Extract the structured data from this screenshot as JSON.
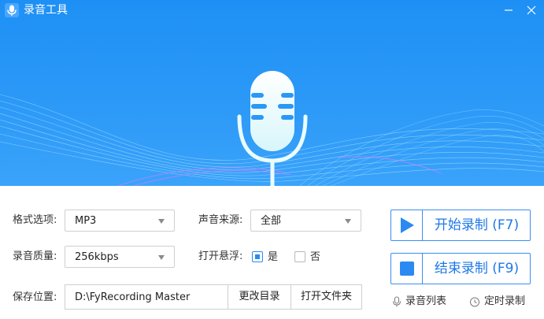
{
  "window": {
    "title": "录音工具",
    "minimize_glyph": "minus-icon",
    "close_glyph": "close-icon"
  },
  "form": {
    "format_label": "格式选项:",
    "format_value": "MP3",
    "source_label": "声音来源:",
    "source_value": "全部",
    "quality_label": "录音质量:",
    "quality_value": "256kbps",
    "float_label": "打开悬浮:",
    "float_yes": "是",
    "float_no": "否",
    "float_checked": "yes",
    "save_label": "保存位置:",
    "save_path": "D:\\FyRecording Master",
    "change_dir": "更改目录",
    "open_folder": "打开文件夹"
  },
  "actions": {
    "start": "开始录制 (F7)",
    "stop": "结束录制 (F9)",
    "list": "录音列表",
    "timer": "定时录制"
  },
  "colors": {
    "header": "#2a98f7",
    "accent": "#2a8af2",
    "button_text": "#1e78e8"
  }
}
